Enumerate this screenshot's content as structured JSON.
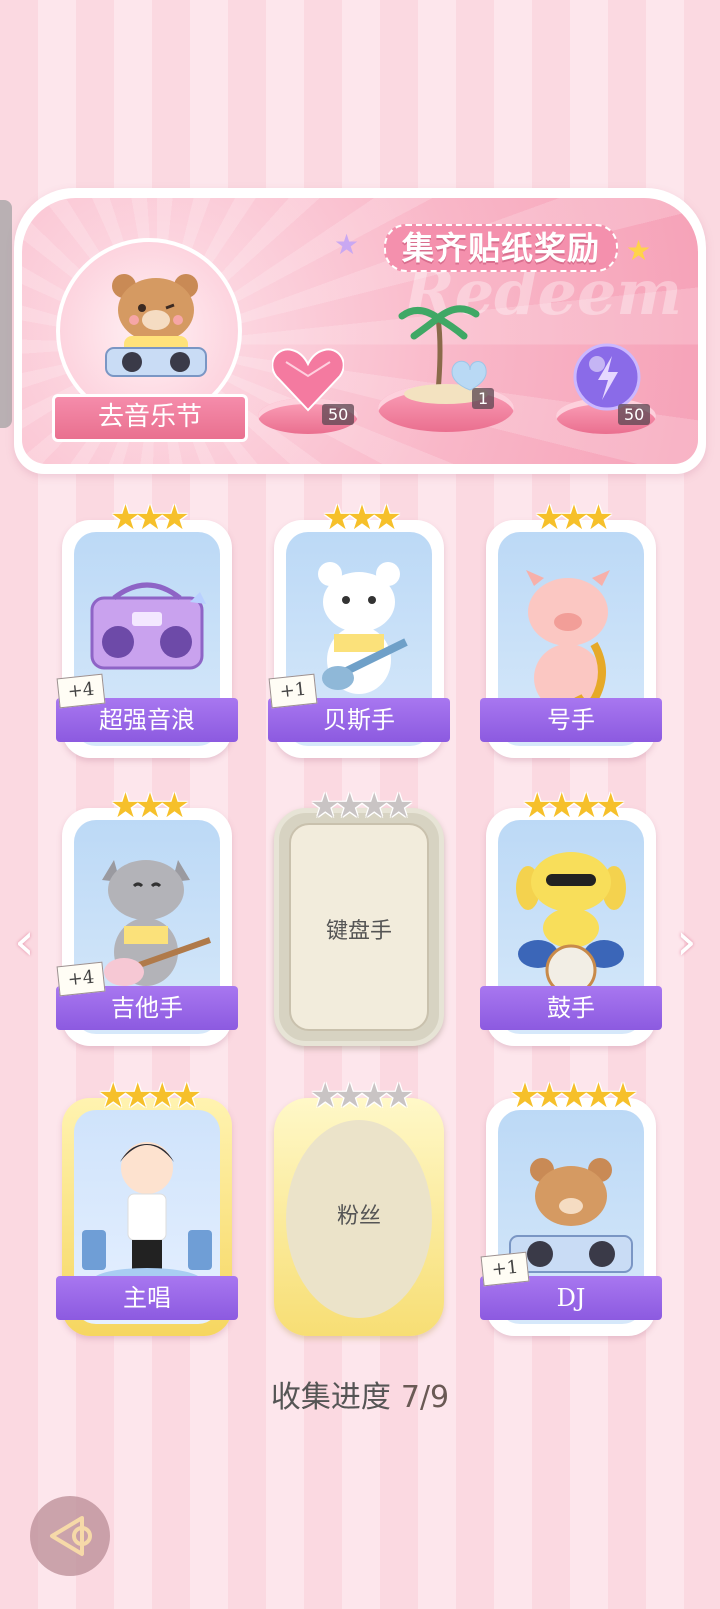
{
  "banner": {
    "title": "集齐贴纸奖励",
    "watermark": "Redeem",
    "festival_button": "去音乐节",
    "rewards": [
      {
        "name": "heart-gem",
        "count": "50"
      },
      {
        "name": "island-decor",
        "count": "1"
      },
      {
        "name": "purple-energy-orb",
        "count": "50"
      }
    ]
  },
  "cards": [
    {
      "name": "超强音浪",
      "stars": 3,
      "plus": "+4",
      "collected": true
    },
    {
      "name": "贝斯手",
      "stars": 3,
      "plus": "+1",
      "collected": true
    },
    {
      "name": "号手",
      "stars": 3,
      "plus": "",
      "collected": true
    },
    {
      "name": "吉他手",
      "stars": 3,
      "plus": "+4",
      "collected": true
    },
    {
      "name": "键盘手",
      "stars": 4,
      "plus": "",
      "collected": false
    },
    {
      "name": "鼓手",
      "stars": 4,
      "plus": "",
      "collected": true
    },
    {
      "name": "主唱",
      "stars": 4,
      "plus": "",
      "collected": true
    },
    {
      "name": "粉丝",
      "stars": 4,
      "plus": "",
      "collected": false
    },
    {
      "name": "DJ",
      "stars": 5,
      "plus": "+1",
      "collected": true
    }
  ],
  "progress": {
    "label": "收集进度",
    "value": "7/9"
  },
  "nav": {
    "prev": "‹",
    "next": "›"
  },
  "icons": {
    "star_filled": "★"
  },
  "colors": {
    "ribbon_purple": "#9a66e8",
    "banner_pink": "#f6a2b8",
    "star_gold": "#f6c02a"
  }
}
